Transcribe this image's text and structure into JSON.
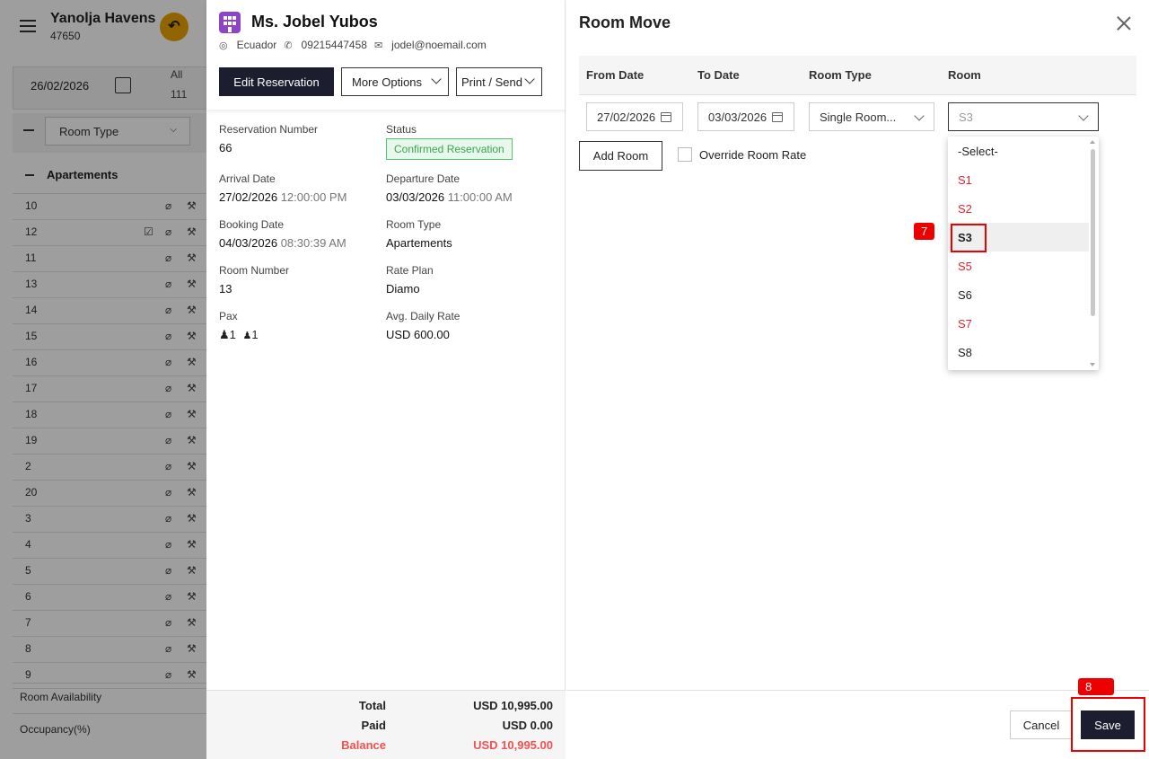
{
  "app": {
    "hotel_name": "Yanolja Havens",
    "hotel_code": "47650",
    "date": "26/02/2026",
    "all_label": "All",
    "all_count": "111",
    "room_type_filter": "Room Type",
    "group_name": "Apartements",
    "rooms": [
      "10",
      "12",
      "11",
      "13",
      "14",
      "15",
      "16",
      "17",
      "18",
      "19",
      "2",
      "20",
      "3",
      "4",
      "5",
      "6",
      "7",
      "8",
      "9"
    ],
    "footer_availability": "Room Availability",
    "footer_occupancy": "Occupancy(%)"
  },
  "reservation": {
    "guest_name": "Ms. Jobel Yubos",
    "country": "Ecuador",
    "phone": "09215447458",
    "email": "jodel@noemail.com",
    "edit_label": "Edit Reservation",
    "more_label": "More Options",
    "print_label": "Print / Send",
    "fields": {
      "reservation_number_label": "Reservation Number",
      "reservation_number": "66",
      "status_label": "Status",
      "status": "Confirmed Reservation",
      "arrival_label": "Arrival Date",
      "arrival_date": "27/02/2026",
      "arrival_time": "12:00:00 PM",
      "departure_label": "Departure Date",
      "departure_date": "03/03/2026",
      "departure_time": "11:00:00 AM",
      "booking_label": "Booking Date",
      "booking_date": "04/03/2026",
      "booking_time": "08:30:39 AM",
      "room_type_label": "Room Type",
      "room_type": "Apartements",
      "room_number_label": "Room Number",
      "room_number": "13",
      "rate_plan_label": "Rate Plan",
      "rate_plan": "Diamo",
      "pax_label": "Pax",
      "pax_adults": "1",
      "pax_children": "1",
      "adr_label": "Avg. Daily Rate",
      "adr": "USD 600.00"
    },
    "totals": {
      "total_label": "Total",
      "total": "USD 10,995.00",
      "paid_label": "Paid",
      "paid": "USD 0.00",
      "balance_label": "Balance",
      "balance": "USD 10,995.00"
    }
  },
  "room_move": {
    "title": "Room Move",
    "headers": {
      "from_date": "From Date",
      "to_date": "To Date",
      "room_type": "Room Type",
      "room": "Room"
    },
    "from_date": "27/02/2026",
    "to_date": "03/03/2026",
    "room_type": "Single Room...",
    "room": "S3",
    "add_room_label": "Add Room",
    "override_label": "Override Room Rate",
    "dropdown_options": [
      "-Select-",
      "S1",
      "S2",
      "S3",
      "S5",
      "S6",
      "S7",
      "S8"
    ],
    "cancel_label": "Cancel",
    "save_label": "Save"
  },
  "annotations": {
    "step7": "7",
    "step8": "8"
  },
  "colors": {
    "accent_dark": "#1c1d2e",
    "unavailable_red": "#e0262f",
    "status_green": "#3aa54f",
    "balance_red": "#f05252",
    "annotation_red": "#ee0000"
  }
}
